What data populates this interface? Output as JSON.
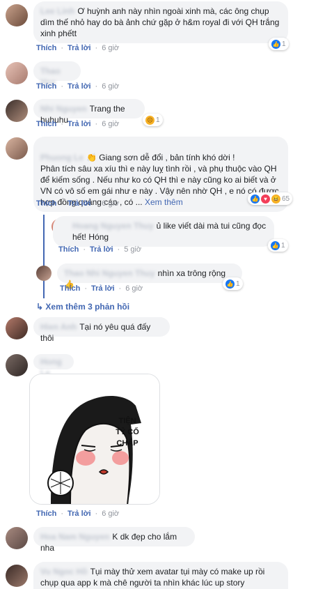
{
  "comments": [
    {
      "name": "Lee Linh",
      "text": "Ơ huỳnh anh này nhìn ngoài xinh mà, các ông chụp dìm thế nhỏ hay do bà  ảnh chứ gặp ở h&m royal đi với QH trắng xinh phếtt",
      "like": "Thích",
      "reply": "Trả lời",
      "time": "6 giờ",
      "react_count": "1"
    },
    {
      "name": "Thao Hee",
      "like": "Thích",
      "reply": "Trả lời",
      "time": "6 giờ"
    },
    {
      "name": "Nhi Nguyen",
      "text": "Trang the huhuhu",
      "like": "Thích",
      "reply": "Trả lời",
      "time": "6 giờ",
      "react_count": "1"
    },
    {
      "name": "Phuong Le",
      "text": "👏 Giang sơn dễ đổi , bản tính khó dời !\nPhân tích sâu xa xíu thì e này luỵ tình rồi , và phụ thuộc vào QH để kiếm sống . Nếu như ko có QH thì e này cũng ko ai biết và ở VN có vô số em gái như e này . Vậy nên nhờ QH , e nó có được hợp đồng quảng cáo , có ...",
      "see_more": "Xem thêm",
      "like": "Thích",
      "reply": "Trả lời",
      "time": "6 giờ",
      "react_count": "65"
    }
  ],
  "replies": [
    {
      "name": "Hoang Nguyen Thuy",
      "text": "ủ like viết dài mà tui cũng đọc hết! Hóng",
      "like": "Thích",
      "reply": "Trả lời",
      "time": "5 giờ",
      "react_count": "1"
    },
    {
      "name": "Thao Nhi Nguyen Thuy",
      "text": "nhìn xa trông rộng 👍",
      "like": "Thích",
      "reply": "Trả lời",
      "time": "6 giờ",
      "react_count": "1"
    }
  ],
  "more_replies": "Xem thêm 3 phản hồi",
  "comments2": [
    {
      "name": "Hien Anh",
      "text": "Tại nó yêu quá đấy thôi",
      "like": "Thích",
      "reply": "Trả lời",
      "time": "6 giờ"
    },
    {
      "name": "Hong Le",
      "like": "Thích",
      "reply": "Trả lời",
      "time": "6 giờ",
      "sticker_text": "TIỆN\nTỶ CỐ\nCHẤP"
    },
    {
      "name": "Hoa Nam Nguyen",
      "text": "K dk đẹp cho lắm nha",
      "like": "Thích",
      "reply": "Trả lời",
      "time": "6 giờ"
    },
    {
      "name": "Vu Ngoc Hồ",
      "text": "Tụi mày thử xem avatar tụi mày có make up rồi chụp qua app k mà chê người ta nhìn khác lúc up story"
    }
  ]
}
